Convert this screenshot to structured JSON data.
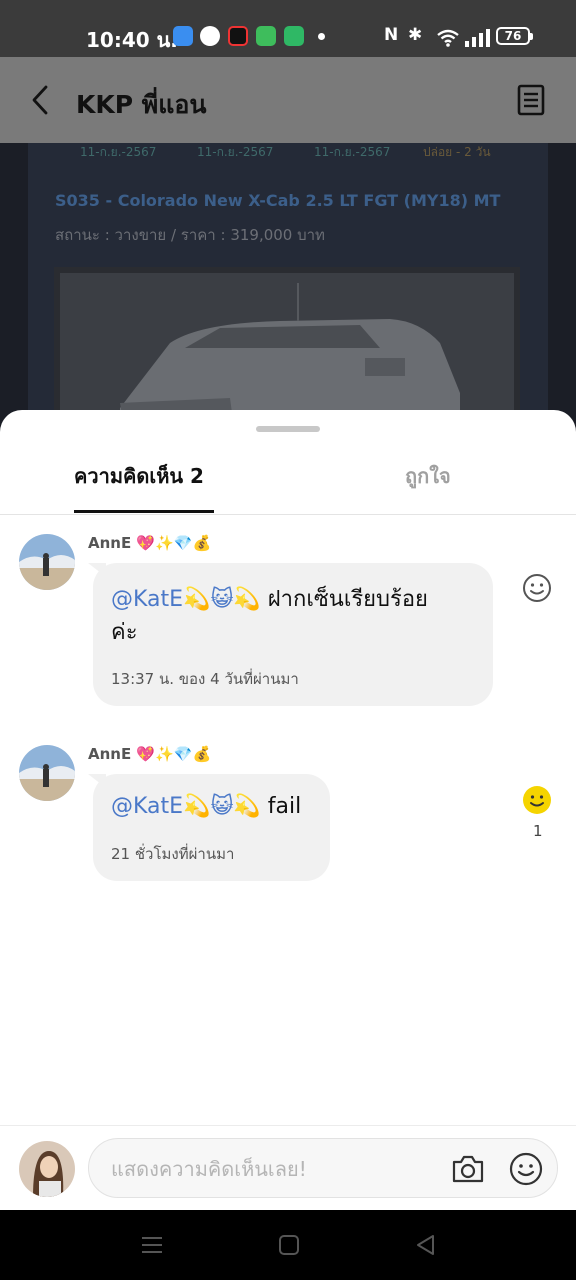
{
  "status_bar": {
    "time": "10:40 น.",
    "battery": "76"
  },
  "header": {
    "title": "KKP พี่แอน"
  },
  "background_post": {
    "dates": [
      "11-ก.ย.-2567",
      "11-ก.ย.-2567",
      "11-ก.ย.-2567",
      "ปล่อย - 2 วัน"
    ],
    "car_title": "S035 - Colorado New X-Cab 2.5 LT FGT (MY18) MT",
    "car_status": "สถานะ : วางขาย / ราคา : 319,000 บาท"
  },
  "tabs": {
    "comments": "ความคิดเห็น 2",
    "likes": "ถูกใจ"
  },
  "comments": [
    {
      "author": "AnnE 💖✨💎💰",
      "mention": "@KatE💫😺💫",
      "text_line1": " ฝากเซ็นเรียบร้อย",
      "text_line2": "ค่ะ",
      "meta": "13:37 น. ของ 4 วันที่ผ่านมา",
      "reaction_count": ""
    },
    {
      "author": "AnnE 💖✨💎💰",
      "mention": "@KatE💫😺💫",
      "text_line1": " fail",
      "meta": "21 ชั่วโมงที่ผ่านมา",
      "reaction_count": "1"
    }
  ],
  "input": {
    "placeholder": "แสดงความคิดเห็นเลย!"
  },
  "colors": {
    "mention": "#4a78c8",
    "reaction_active": "#f5d400"
  }
}
